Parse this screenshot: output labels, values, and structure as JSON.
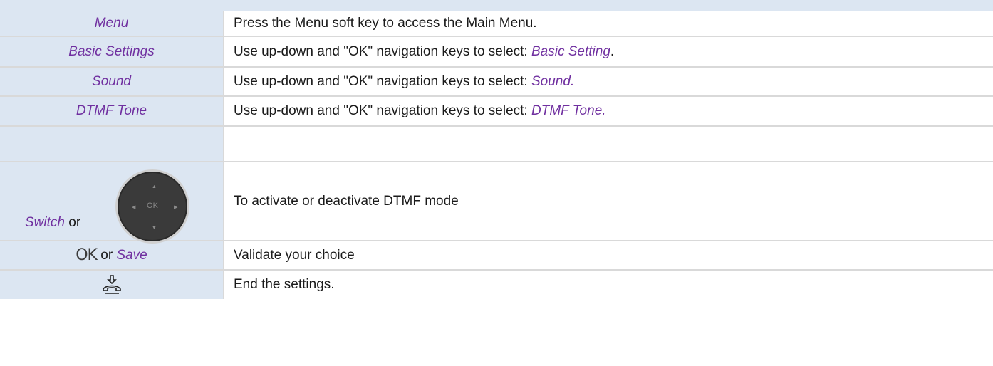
{
  "rows": [
    {
      "key": "Menu",
      "desc": "Press the Menu soft key to access the Main Menu."
    },
    {
      "key": "Basic Settings",
      "desc_prefix": "Use up-down and \"OK\" navigation keys to select: ",
      "desc_em": "Basic Setting",
      "desc_suffix": "."
    },
    {
      "key": "Sound",
      "desc_prefix": "Use up-down and \"OK\" navigation keys to select: ",
      "desc_em": "Sound."
    },
    {
      "key": "DTMF Tone",
      "desc_prefix": "Use up-down and \"OK\" navigation keys to select: ",
      "desc_em": "DTMF Tone."
    },
    {
      "key": "",
      "desc": ""
    },
    {
      "key_em": "Switch",
      "key_suffix": " or",
      "nav_ok": "OK",
      "desc": "To activate or deactivate DTMF mode"
    },
    {
      "ok_glyph": "OK",
      "key_mid": " or ",
      "key_em": "Save",
      "desc": "Validate your choice"
    },
    {
      "icon": "hang-up-icon",
      "desc": "End the settings."
    }
  ],
  "colors": {
    "key_bg": "#dce6f2",
    "italic_text": "#7030a0",
    "border": "#d9d9d9"
  }
}
